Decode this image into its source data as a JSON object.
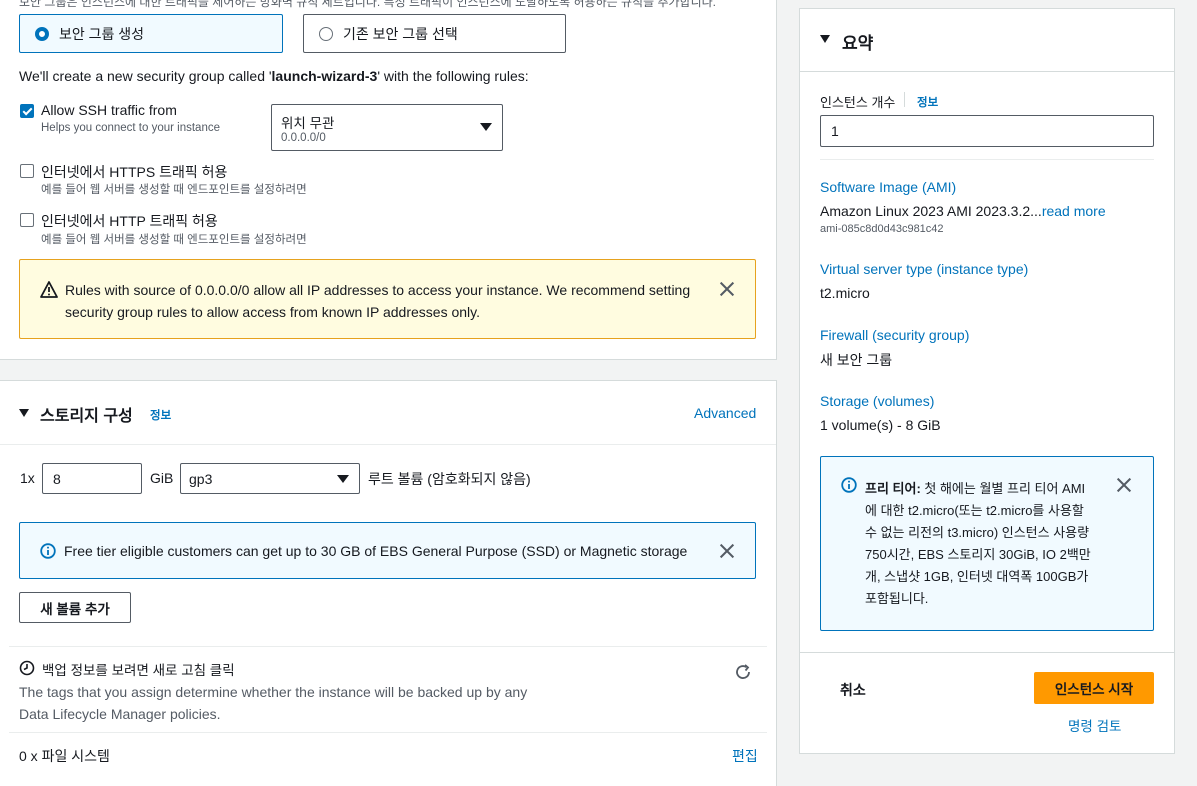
{
  "network": {
    "top_cut_text": "보안 그룹은 인스턴스에 대한 트래픽을 제어하는 방화벽 규칙 세트입니다. 특정 트래픽이 인스턴스에 도달하도록 허용하는 규칙을 추가합니다.",
    "radio_create": "보안 그룹 생성",
    "radio_select_existing": "기존 보안 그룹 선택",
    "intro_prefix": "We'll create a new security group called '",
    "sg_name": "launch-wizard-3",
    "intro_suffix": "' with the following rules:",
    "ssh_label": "Allow SSH traffic from",
    "ssh_help": "Helps you connect to your instance",
    "ssh_checked": true,
    "ssh_source_value": "위치 무관",
    "ssh_source_sub": "0.0.0.0/0",
    "https_label": "인터넷에서 HTTPS 트래픽 허용",
    "https_help": "예를 들어 웹 서버를 생성할 때 엔드포인트를 설정하려면",
    "http_label": "인터넷에서 HTTP 트래픽 허용",
    "http_help": "예를 들어 웹 서버를 생성할 때 엔드포인트를 설정하려면",
    "warning_line1": "Rules with source of 0.0.0.0/0 allow all IP addresses to access your instance. We recommend setting",
    "warning_line2": "security group rules to allow access from known IP addresses only."
  },
  "storage": {
    "title": "스토리지 구성",
    "info_link": "정보",
    "advanced_link": "Advanced",
    "count_prefix": "1x",
    "size_value": "8",
    "size_unit": "GiB",
    "volume_type": "gp3",
    "root_volume_label": "루트 볼륨  (암호화되지 않음)",
    "free_tier_info": "Free tier eligible customers can get up to 30 GB of EBS General Purpose (SSD) or Magnetic storage",
    "add_volume_button": "새 볼륨 추가",
    "backup_title": "백업 정보를 보려면 새로 고침 클릭",
    "backup_desc_line1": "The tags that you assign determine whether the instance will be backed up by any",
    "backup_desc_line2": "Data Lifecycle Manager policies.",
    "file_systems": "0 x 파일 시스템",
    "edit_link": "편집"
  },
  "summary": {
    "title": "요약",
    "instance_count_label": "인스턴스 개수",
    "instance_count_info": "정보",
    "instance_count_value": "1",
    "ami_label": "Software Image (AMI)",
    "ami_value": "Amazon Linux 2023 AMI 2023.3.2...",
    "ami_read_more": "read more",
    "ami_id": "ami-085c8d0d43c981c42",
    "instance_type_label": "Virtual server type (instance type)",
    "instance_type_value": "t2.micro",
    "firewall_label": "Firewall (security group)",
    "firewall_value": "새 보안 그룹",
    "storage_label": "Storage (volumes)",
    "storage_value": "1 volume(s) - 8 GiB",
    "free_tier_bold": "프리 티어:",
    "free_tier_lines": [
      " 첫 해에는 월별 프리 티어 AMI",
      "에 대한 t2.micro(또는 t2.micro를 사용할",
      "수 없는 리전의 t3.micro) 인스턴스 사용량",
      "750시간, EBS 스토리지 30GiB, IO 2백만",
      "개, 스냅샷 1GB, 인터넷 대역폭 100GB가",
      "포함됩니다."
    ],
    "cancel_button": "취소",
    "launch_button": "인스턴스 시작",
    "review_commands_link": "명령 검토"
  },
  "colors": {
    "accent_blue": "#0073bb",
    "primary_orange": "#ff9900",
    "warning_border": "#e6a21e",
    "warning_bg": "#fffce0",
    "info_bg": "#f1faff"
  }
}
